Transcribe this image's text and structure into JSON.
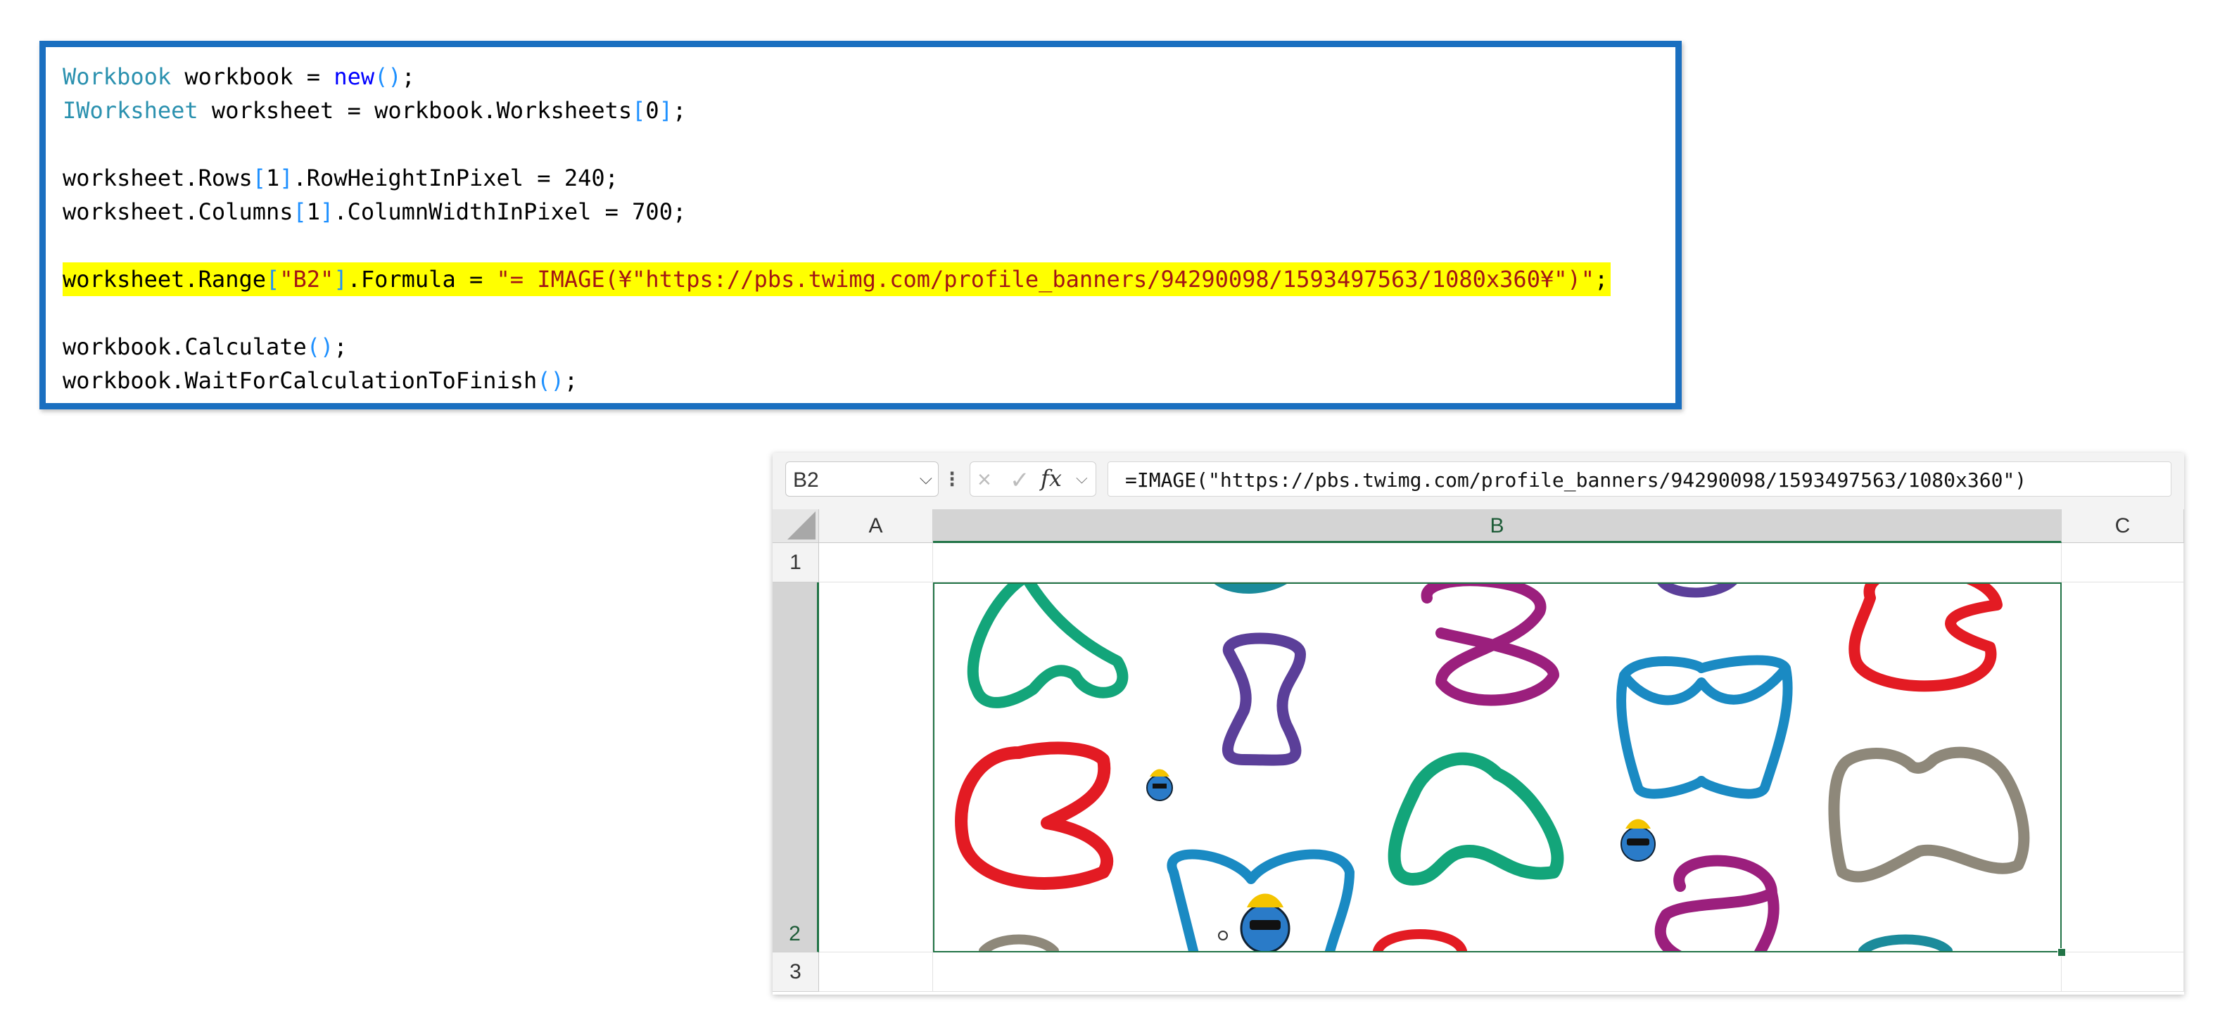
{
  "code": {
    "lines": [
      {
        "parts": [
          {
            "t": "Workbook",
            "c": "kw-type"
          },
          {
            "t": " workbook = "
          },
          {
            "t": "new",
            "c": "kw"
          },
          {
            "t": "()",
            "c": "br"
          },
          {
            "t": ";"
          }
        ]
      },
      {
        "parts": [
          {
            "t": "IWorksheet",
            "c": "kw-type"
          },
          {
            "t": " worksheet = workbook.Worksheets"
          },
          {
            "t": "[",
            "c": "br"
          },
          {
            "t": "0"
          },
          {
            "t": "]",
            "c": "br"
          },
          {
            "t": ";"
          }
        ]
      },
      {
        "parts": []
      },
      {
        "parts": [
          {
            "t": "worksheet.Rows"
          },
          {
            "t": "[",
            "c": "br"
          },
          {
            "t": "1"
          },
          {
            "t": "]",
            "c": "br"
          },
          {
            "t": ".RowHeightInPixel = 240;"
          }
        ]
      },
      {
        "parts": [
          {
            "t": "worksheet.Columns"
          },
          {
            "t": "[",
            "c": "br"
          },
          {
            "t": "1"
          },
          {
            "t": "]",
            "c": "br"
          },
          {
            "t": ".ColumnWidthInPixel = 700;"
          }
        ]
      },
      {
        "parts": []
      },
      {
        "highlight": true,
        "parts": [
          {
            "t": "worksheet.Range"
          },
          {
            "t": "[",
            "c": "br"
          },
          {
            "t": "\"B2\"",
            "c": "str"
          },
          {
            "t": "]",
            "c": "br"
          },
          {
            "t": ".Formula = "
          },
          {
            "t": "\"= IMAGE(¥\"https://pbs.twimg.com/profile_banners/94290098/1593497563/1080x360¥\")\"",
            "c": "str"
          },
          {
            "t": ";"
          }
        ]
      },
      {
        "parts": []
      },
      {
        "parts": [
          {
            "t": "workbook.Calculate"
          },
          {
            "t": "()",
            "c": "br"
          },
          {
            "t": ";"
          }
        ]
      },
      {
        "parts": [
          {
            "t": "workbook.WaitForCalculationToFinish"
          },
          {
            "t": "()",
            "c": "br"
          },
          {
            "t": ";"
          }
        ]
      }
    ]
  },
  "spreadsheet": {
    "name_box": "B2",
    "separator": "⁝",
    "cancel_icon": "×",
    "enter_icon": "✓",
    "fx_label": "fx",
    "formula": "=IMAGE(\"https://pbs.twimg.com/profile_banners/94290098/1593497563/1080x360\")",
    "columns": [
      "A",
      "B",
      "C"
    ],
    "rows": [
      "1",
      "2",
      "3"
    ],
    "selected_cell": "B2",
    "colors": {
      "selection": "#217346",
      "header_selected": "#d4d4d4"
    }
  }
}
